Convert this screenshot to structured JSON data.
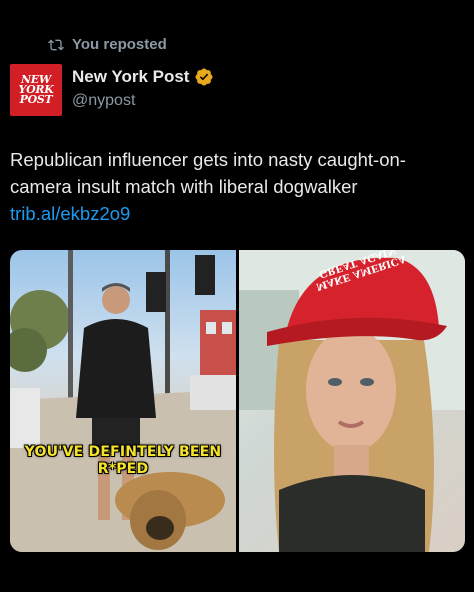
{
  "repost": {
    "label": "You reposted",
    "icon": "repost-icon"
  },
  "account": {
    "name": "New York Post",
    "handle": "@nypost",
    "avatar_lines": [
      "NEW",
      "YORK",
      "POST"
    ],
    "verified_color": "#e8a91c",
    "brand_color": "#d21f26"
  },
  "tweet": {
    "text": "Republican influencer gets into nasty caught-on-camera insult match with liberal dogwalker ",
    "link": "trib.al/ekbz2o9"
  },
  "media": {
    "left_caption_line1": "YOU'VE DEFINTELY BEEN",
    "left_caption_line2": "R*PED",
    "hat_text": "MAKE AMERICA GREAT AGAIN"
  }
}
